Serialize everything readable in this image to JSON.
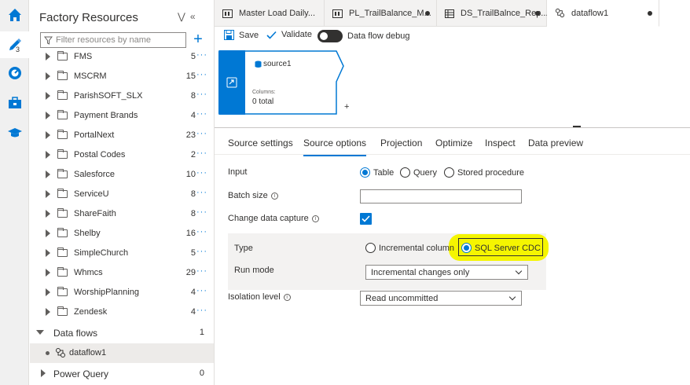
{
  "rail": {
    "badge": "3"
  },
  "resources": {
    "title": "Factory Resources",
    "search_placeholder": "Filter resources by name",
    "add": "+",
    "items": [
      {
        "name": "FMS",
        "count": "5"
      },
      {
        "name": "MSCRM",
        "count": "15"
      },
      {
        "name": "ParishSOFT_SLX",
        "count": "8"
      },
      {
        "name": "Payment Brands",
        "count": "4"
      },
      {
        "name": "PortalNext",
        "count": "23"
      },
      {
        "name": "Postal Codes",
        "count": "2"
      },
      {
        "name": "Salesforce",
        "count": "10"
      },
      {
        "name": "ServiceU",
        "count": "8"
      },
      {
        "name": "ShareFaith",
        "count": "8"
      },
      {
        "name": "Shelby",
        "count": "16"
      },
      {
        "name": "SimpleChurch",
        "count": "5"
      },
      {
        "name": "Whmcs",
        "count": "29"
      },
      {
        "name": "WorshipPlanning",
        "count": "4"
      },
      {
        "name": "Zendesk",
        "count": "4"
      }
    ],
    "more": "···",
    "data_flows": {
      "label": "Data flows",
      "count": "1"
    },
    "dataflow_item": "dataflow1",
    "power_query": {
      "label": "Power Query",
      "count": "0"
    }
  },
  "tabs": [
    {
      "label": "Master Load Daily...",
      "dirty": false
    },
    {
      "label": "PL_TrailBalance_M...",
      "dirty": true
    },
    {
      "label": "DS_TrailBalnce_Rep...",
      "dirty": true
    },
    {
      "label": "dataflow1",
      "dirty": true
    }
  ],
  "toolbar": {
    "save": "Save",
    "validate": "Validate",
    "debug": "Data flow debug"
  },
  "node": {
    "title": "source1",
    "columns_label": "Columns:",
    "columns_value": "0 total",
    "plus": "+"
  },
  "panel_tabs": [
    "Source settings",
    "Source options",
    "Projection",
    "Optimize",
    "Inspect",
    "Data preview"
  ],
  "form": {
    "input_label": "Input",
    "input_options": [
      "Table",
      "Query",
      "Stored procedure"
    ],
    "input_selected": "Table",
    "batch_label": "Batch size",
    "cdc_label": "Change data capture",
    "type_label": "Type",
    "type_options": [
      "Incremental column",
      "SQL Server CDC"
    ],
    "type_selected": "SQL Server CDC",
    "run_mode_label": "Run mode",
    "run_mode_value": "Incremental changes only",
    "isolation_label": "Isolation level",
    "isolation_value": "Read uncommitted"
  },
  "colors": {
    "accent": "#0078d4",
    "highlight": "#f5f500"
  }
}
